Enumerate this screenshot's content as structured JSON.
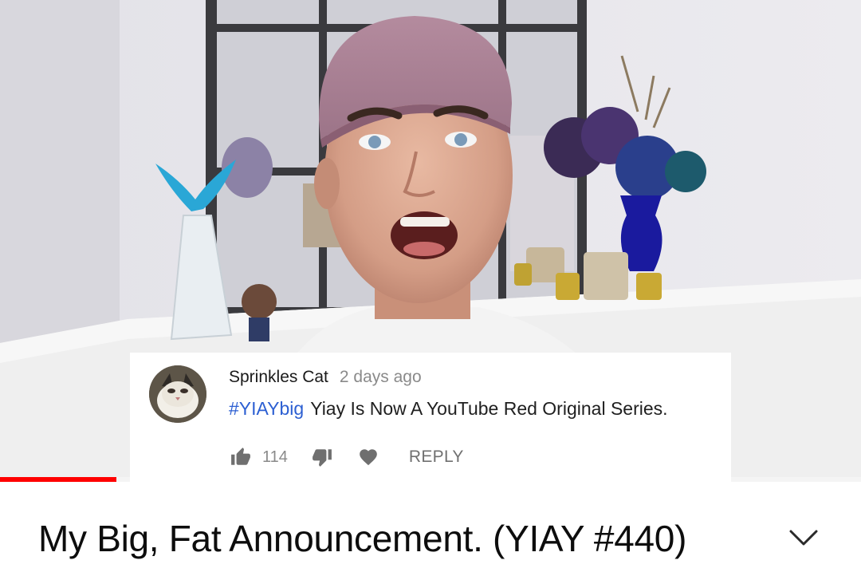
{
  "video": {
    "progress_fraction": 0.135
  },
  "comment": {
    "author": "Sprinkles Cat",
    "time": "2 days ago",
    "hashtag": "#YIAYbig",
    "text": "Yiay Is Now A YouTube Red Original Series.",
    "like_count": "114",
    "reply_label": "REPLY",
    "hashtag_color": "#2c5fd2"
  },
  "title": {
    "text": "My Big, Fat Announcement. (YIAY #440)"
  },
  "icons": {
    "like": "thumbs-up-icon",
    "dislike": "thumbs-down-icon",
    "heart": "heart-icon",
    "expand": "chevron-down-icon"
  },
  "colors": {
    "progress": "#ff0000",
    "background": "#ffffff"
  }
}
